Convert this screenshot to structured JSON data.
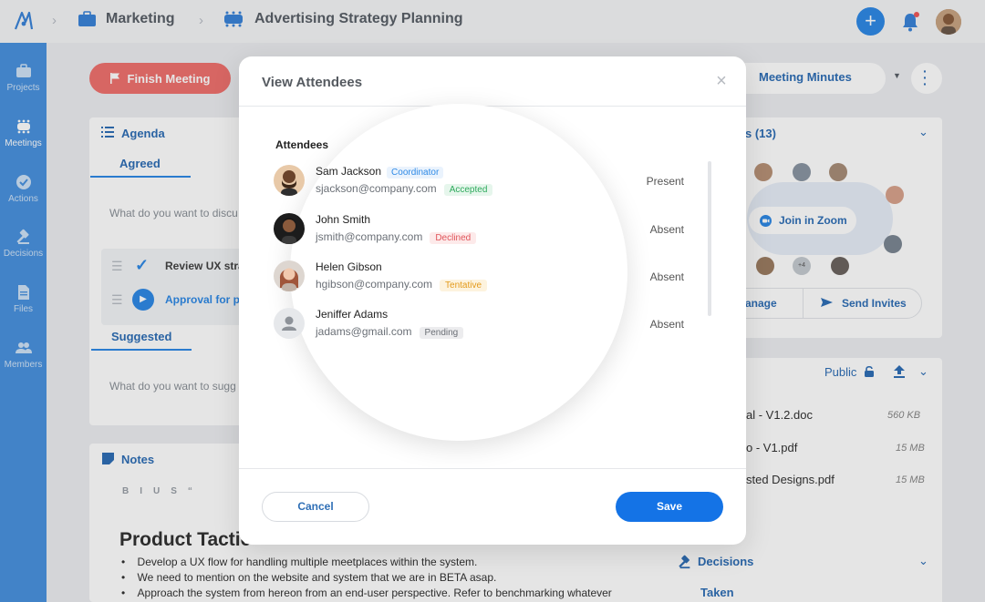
{
  "header": {
    "breadcrumbs": [
      "Marketing",
      "Advertising Strategy Planning"
    ]
  },
  "sidebar": {
    "items": [
      {
        "label": "Projects",
        "icon": "briefcase-icon"
      },
      {
        "label": "Meetings",
        "icon": "meeting-icon"
      },
      {
        "label": "Actions",
        "icon": "check-circle-icon"
      },
      {
        "label": "Decisions",
        "icon": "gavel-icon"
      },
      {
        "label": "Files",
        "icon": "file-icon"
      },
      {
        "label": "Members",
        "icon": "people-icon"
      }
    ]
  },
  "background": {
    "finish_meeting": "Finish Meeting",
    "agenda_title": "Agenda",
    "agreed_tab": "Agreed",
    "agenda_placeholder": "What do you want to discu",
    "agenda_item_1": "Review UX stra",
    "agenda_item_2": "Approval for pr",
    "suggested_tab": "Suggested",
    "suggest_placeholder": "What do you want to sugg",
    "notes_title": "Notes",
    "notes_heading": "Product Tactic",
    "notes_bullets": [
      "Develop a UX flow for handling multiple meetplaces within the system.",
      "We need to mention on the website and system that we are in BETA asap.",
      "Approach the system from hereon from an end-user perspective. Refer to benchmarking whatever"
    ],
    "meeting_minutes": "Meeting Minutes",
    "participants_title": "s (13)",
    "join_zoom": "Join in Zoom",
    "manage": "anage",
    "send_invites": "Send Invites",
    "files_visibility": "Public",
    "files": [
      {
        "name": "al - V1.2.doc",
        "size": "560 KB"
      },
      {
        "name": "o - V1.pdf",
        "size": "15 MB"
      },
      {
        "name": "sted Designs.pdf",
        "size": "15 MB"
      }
    ],
    "decisions_title": "Decisions",
    "taken_tab": "Taken"
  },
  "modal": {
    "title": "View Attendees",
    "section_label": "Attendees",
    "attendees": [
      {
        "name": "Sam Jackson",
        "role": "Coordinator",
        "email": "sjackson@company.com",
        "status": "Accepted",
        "presence": "Present"
      },
      {
        "name": "John Smith",
        "role": "",
        "email": "jsmith@company.com",
        "status": "Declined",
        "presence": "Absent"
      },
      {
        "name": "Helen Gibson",
        "role": "",
        "email": "hgibson@company.com",
        "status": "Tentative",
        "presence": "Absent"
      },
      {
        "name": "Jeniffer Adams",
        "role": "",
        "email": "jadams@gmail.com",
        "status": "Pending",
        "presence": "Absent"
      }
    ],
    "cancel_label": "Cancel",
    "save_label": "Save"
  },
  "colors": {
    "accent": "#1473e6",
    "sidebar": "#4a92df",
    "accepted": "#2eaa5c",
    "declined": "#e0555b",
    "tentative": "#e39a1b",
    "pending": "#6b6f76"
  }
}
